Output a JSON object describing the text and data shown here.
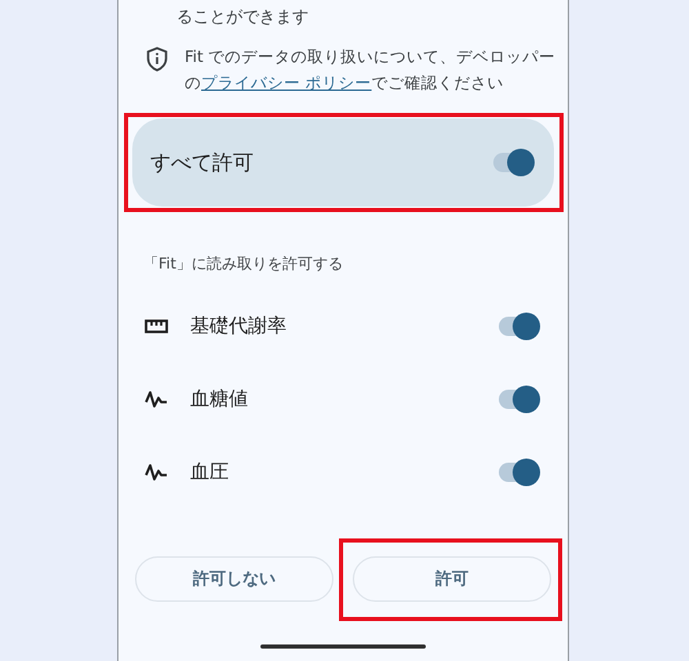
{
  "intro_tail": "ることができます",
  "privacy": {
    "before": "Fit でのデータの取り扱いについて、デベロッパーの",
    "link": "プライバシー ポリシー",
    "after": "でご確認ください"
  },
  "allow_all": {
    "label": "すべて許可",
    "on": true,
    "highlighted": true
  },
  "section_label": "「Fit」に読み取りを許可する",
  "permissions": [
    {
      "kind": "ruler",
      "label": "基礎代謝率",
      "on": true
    },
    {
      "kind": "pulse",
      "label": "血糖値",
      "on": true
    },
    {
      "kind": "pulse",
      "label": "血圧",
      "on": true
    }
  ],
  "buttons": [
    {
      "label": "許可しない",
      "highlighted": false
    },
    {
      "label": "許可",
      "highlighted": true
    }
  ]
}
